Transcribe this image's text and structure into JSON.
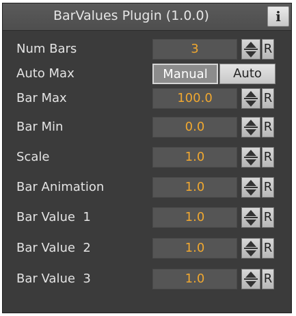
{
  "panel": {
    "title": "BarValues Plugin (1.0.0)",
    "info_label": "i"
  },
  "rows": [
    {
      "label": "Num Bars",
      "value": "3",
      "reset_label": "R"
    },
    {
      "label": "Auto Max",
      "options": [
        "Manual",
        "Auto"
      ],
      "selected": "Manual"
    },
    {
      "label": "Bar Max",
      "value": "100.0",
      "reset_label": "R"
    },
    {
      "label": "Bar Min",
      "value": "0.0",
      "reset_label": "R"
    },
    {
      "label": "Scale",
      "value": "1.0",
      "reset_label": "R"
    },
    {
      "label": "Bar Animation",
      "value": "1.0",
      "reset_label": "R"
    },
    {
      "label": "Bar Value  1",
      "value": "1.0",
      "reset_label": "R"
    },
    {
      "label": "Bar Value  2",
      "value": "1.0",
      "reset_label": "R"
    },
    {
      "label": "Bar Value  3",
      "value": "1.0",
      "reset_label": "R"
    }
  ],
  "colors": {
    "panel_background": "#3b3b3b",
    "value_text": "#f0a830",
    "label_text": "#e4e4e4",
    "field_background": "#555555"
  },
  "icons": {
    "info": "info-icon",
    "spinner": "spinner-updown-icon"
  }
}
